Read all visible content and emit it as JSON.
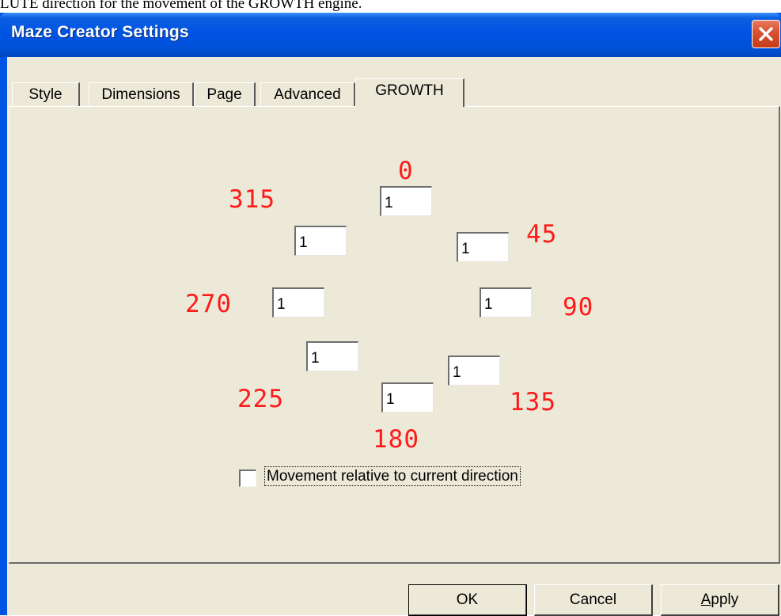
{
  "caption": "LUTE direction for the movement of the GROWTH engine.",
  "window": {
    "title": "Maze Creator Settings"
  },
  "tabs": [
    {
      "label": "Style"
    },
    {
      "label": "Dimensions"
    },
    {
      "label": "Page"
    },
    {
      "label": "Advanced"
    },
    {
      "label": "GROWTH",
      "selected": true
    }
  ],
  "growth": {
    "labels": {
      "d0": "0",
      "d45": "45",
      "d90": "90",
      "d135": "135",
      "d180": "180",
      "d225": "225",
      "d270": "270",
      "d315": "315"
    },
    "weights": {
      "d0": "1",
      "d45": "1",
      "d90": "1",
      "d135": "1",
      "d180": "1",
      "d225": "1",
      "d270": "1",
      "d315": "1"
    },
    "label_color": "#ff1a1a"
  },
  "relative": {
    "label": "Movement relative to current direction",
    "checked": false
  },
  "buttons": {
    "ok": "OK",
    "cancel": "Cancel",
    "apply_prefix": "A",
    "apply_rest": "pply"
  }
}
